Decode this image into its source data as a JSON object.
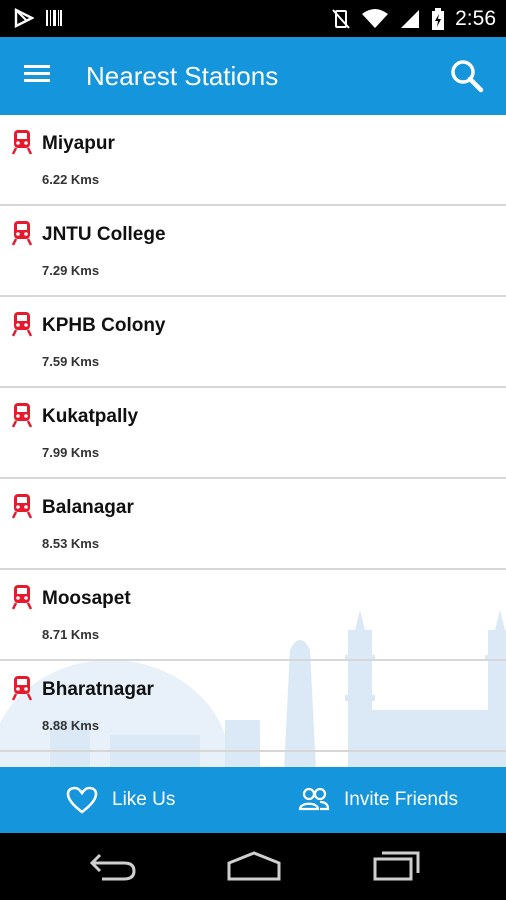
{
  "status_bar": {
    "time": "2:56",
    "icons": [
      "play-store-notification-icon",
      "barcode-notification-icon",
      "vibrate-off-icon",
      "wifi-icon",
      "signal-icon",
      "battery-icon"
    ]
  },
  "app_bar": {
    "title": "Nearest Stations",
    "menu_icon": "hamburger-menu-icon",
    "search_icon": "search-icon"
  },
  "stations": [
    {
      "name": "Miyapur",
      "distance": "6.22 Kms"
    },
    {
      "name": "JNTU College",
      "distance": "7.29 Kms"
    },
    {
      "name": "KPHB Colony",
      "distance": "7.59 Kms"
    },
    {
      "name": "Kukatpally",
      "distance": "7.99 Kms"
    },
    {
      "name": "Balanagar",
      "distance": "8.53 Kms"
    },
    {
      "name": "Moosapet",
      "distance": "8.71 Kms"
    },
    {
      "name": "Bharatnagar",
      "distance": "8.88 Kms"
    }
  ],
  "bottom_bar": {
    "like_label": "Like Us",
    "invite_label": "Invite Friends"
  },
  "colors": {
    "primary": "#1596dc",
    "train_icon": "#e8192c",
    "skyline": "#d6e8f6"
  }
}
